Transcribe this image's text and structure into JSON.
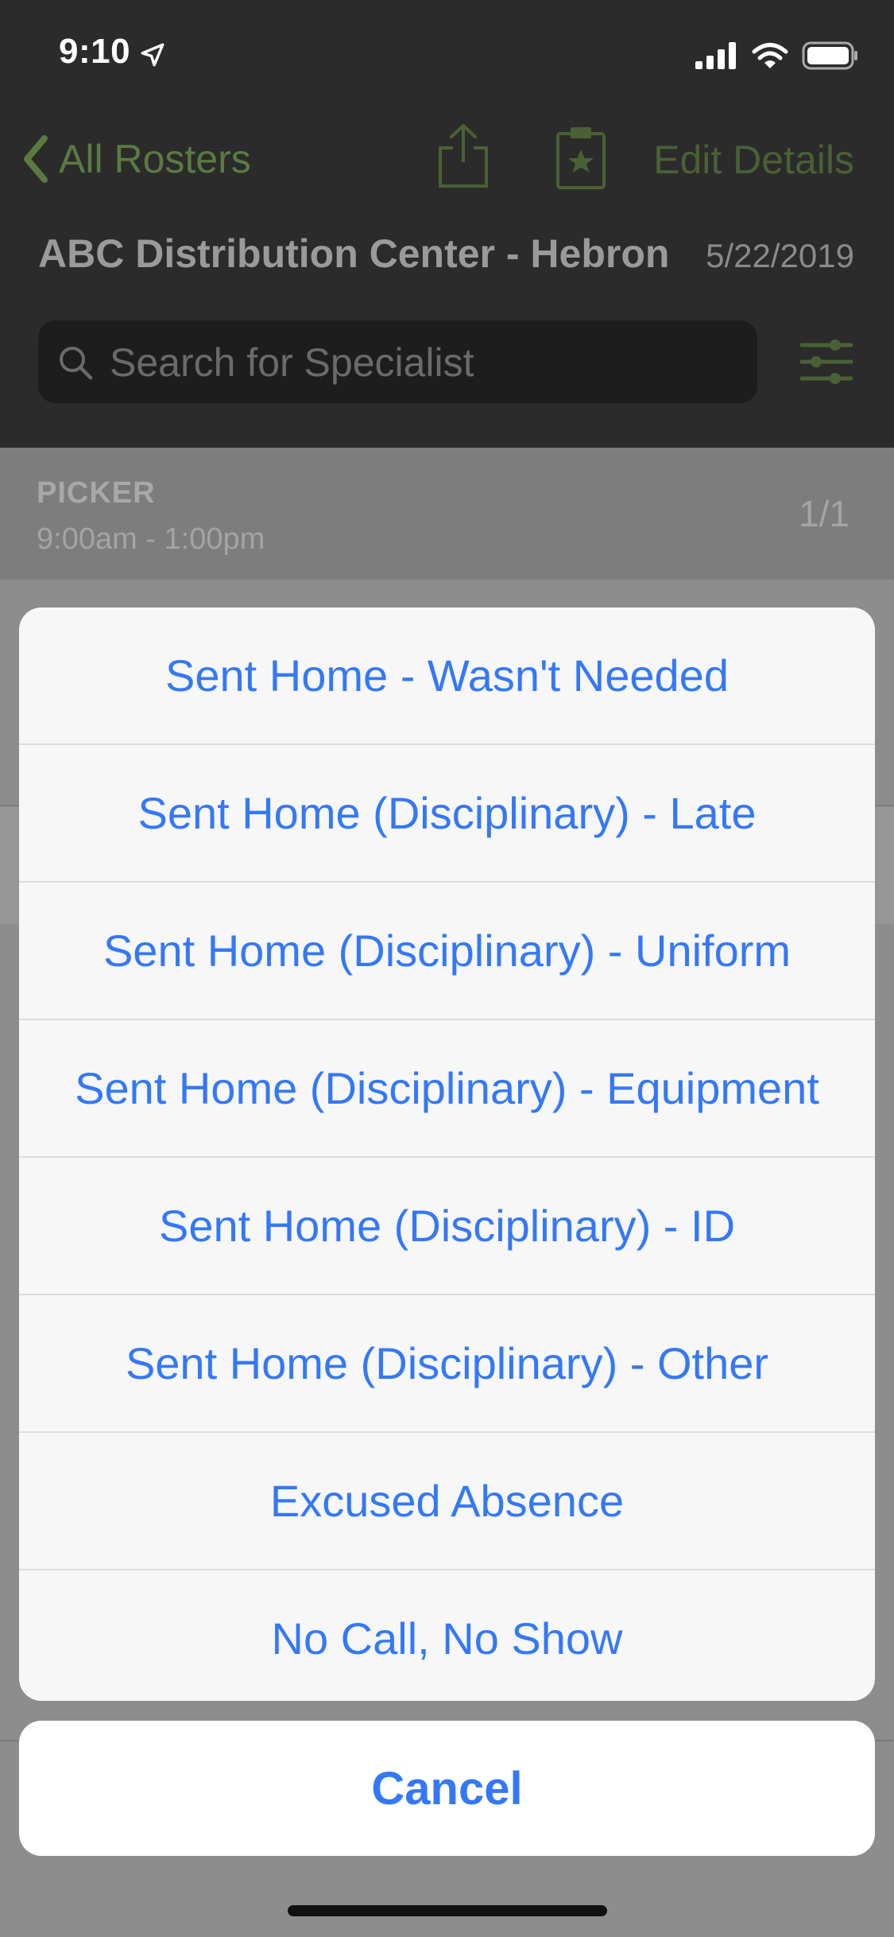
{
  "status_bar": {
    "time": "9:10",
    "icons": [
      "location-arrow-icon",
      "cellular-signal-icon",
      "wifi-icon",
      "battery-icon"
    ]
  },
  "nav": {
    "back_label": "All Rosters",
    "edit_label": "Edit Details",
    "icons": [
      "chevron-left-icon",
      "share-icon",
      "clipboard-star-icon"
    ]
  },
  "roster": {
    "title": "ABC Distribution Center - Hebron",
    "date": "5/22/2019"
  },
  "search": {
    "placeholder": "Search for Specialist",
    "icons": [
      "search-icon",
      "filter-sliders-icon"
    ]
  },
  "section": {
    "title": "PICKER",
    "time": "9:00am - 1:00pm",
    "count": "1/1"
  },
  "action_sheet": {
    "options": [
      "Sent Home - Wasn't Needed",
      "Sent Home (Disciplinary) - Late",
      "Sent Home (Disciplinary) - Uniform",
      "Sent Home (Disciplinary) - Equipment",
      "Sent Home (Disciplinary) - ID",
      "Sent Home (Disciplinary) - Other",
      "Excused Absence",
      "No Call, No Show"
    ],
    "cancel_label": "Cancel"
  },
  "colors": {
    "accent": "#5b7a42",
    "action_blue": "#3478f6",
    "header_bg": "#2b2b2b",
    "overlay_bg": "#8d8d8d"
  }
}
